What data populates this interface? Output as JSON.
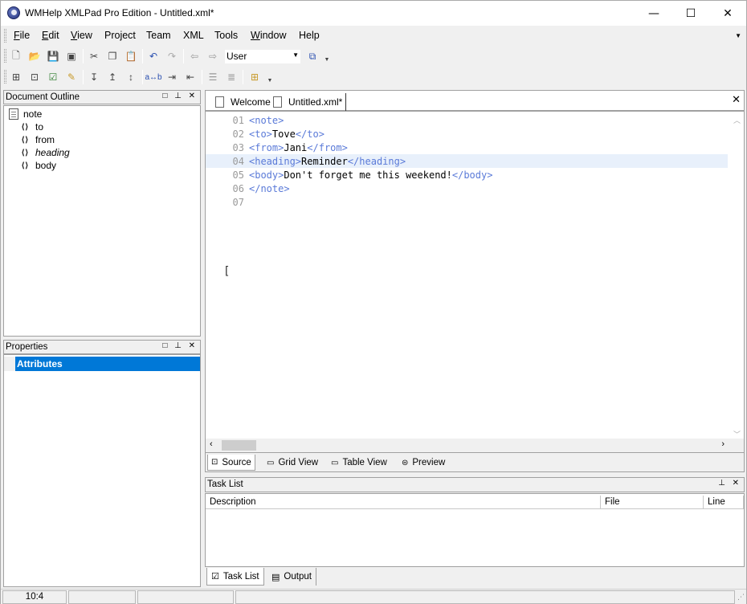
{
  "window": {
    "title": "WMHelp XMLPad Pro Edition - Untitled.xml*",
    "minimize": "—",
    "maximize": "☐",
    "close": "✕"
  },
  "menu": [
    "File",
    "Edit",
    "View",
    "Project",
    "Team",
    "XML",
    "Tools",
    "Window",
    "Help"
  ],
  "menu_mnemonic_index": [
    0,
    0,
    0,
    -1,
    -1,
    -1,
    -1,
    0,
    -1
  ],
  "toolbar": {
    "profile_value": "User"
  },
  "outline": {
    "title": "Document Outline",
    "root": "note",
    "children": [
      "to",
      "from",
      "heading",
      "body"
    ],
    "selected": "heading"
  },
  "properties": {
    "title": "Properties",
    "section": "Attributes"
  },
  "tabs": [
    {
      "label": "Welcome"
    },
    {
      "label": "Untitled.xml*"
    }
  ],
  "editor": {
    "lines": [
      {
        "num": "01",
        "parts": [
          [
            "tag",
            "<note>"
          ]
        ]
      },
      {
        "num": "02",
        "parts": [
          [
            "tag",
            "<to>"
          ],
          [
            "txt",
            "Tove"
          ],
          [
            "tag",
            "</to>"
          ]
        ]
      },
      {
        "num": "03",
        "parts": [
          [
            "tag",
            "<from>"
          ],
          [
            "txt",
            "Jani"
          ],
          [
            "tag",
            "</from>"
          ]
        ]
      },
      {
        "num": "04",
        "parts": [
          [
            "tag",
            "<heading>"
          ],
          [
            "txt",
            "Reminder"
          ],
          [
            "tag",
            "</heading>"
          ]
        ]
      },
      {
        "num": "05",
        "parts": [
          [
            "tag",
            "<body>"
          ],
          [
            "txt",
            "Don't forget me this weekend!"
          ],
          [
            "tag",
            "</body>"
          ]
        ]
      },
      {
        "num": "06",
        "parts": [
          [
            "tag",
            "</note>"
          ]
        ]
      },
      {
        "num": "07",
        "parts": []
      }
    ],
    "highlight_line": "04"
  },
  "view_tabs": [
    "Source",
    "Grid View",
    "Table View",
    "Preview"
  ],
  "tasklist": {
    "title": "Task List",
    "columns": [
      "Description",
      "File",
      "Line"
    ]
  },
  "bottom_tabs": [
    "Task List",
    "Output"
  ],
  "status": {
    "position": "10:4"
  }
}
